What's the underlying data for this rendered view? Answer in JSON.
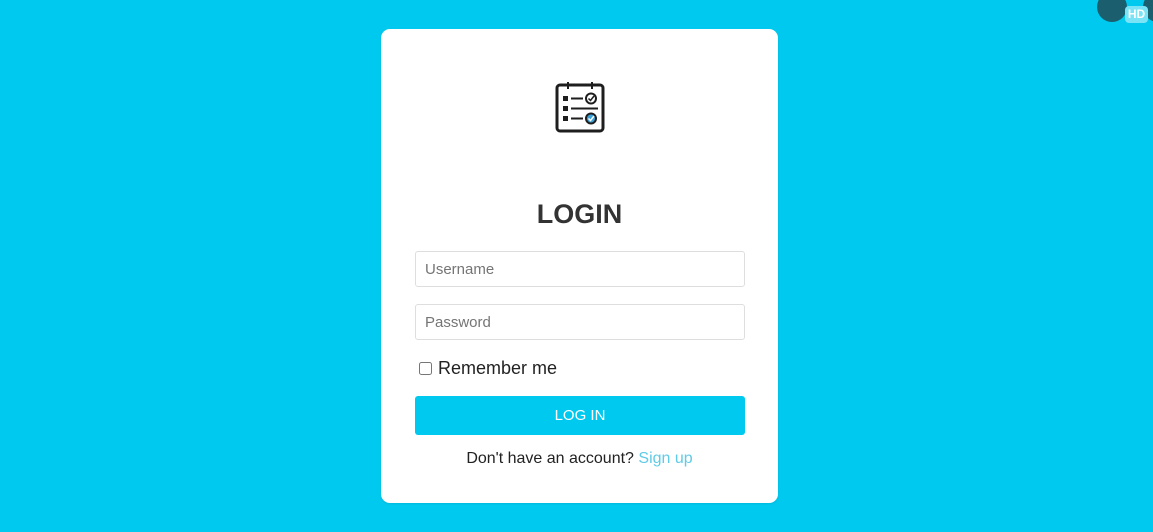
{
  "colors": {
    "background": "#00c9ef",
    "card": "#ffffff",
    "button": "#00c9ef",
    "link": "#5fcbe6",
    "title": "#333333"
  },
  "logo": {
    "icon": "checklist-icon"
  },
  "login": {
    "title": "LOGIN",
    "username": {
      "placeholder": "Username",
      "value": ""
    },
    "password": {
      "placeholder": "Password",
      "value": ""
    },
    "remember_label": "Remember me",
    "remember_checked": false,
    "button_label": "LOG IN",
    "signup_prompt": "Don't have an account?",
    "signup_link": "Sign up"
  },
  "player_overlay": {
    "hd_badge": "HD"
  }
}
